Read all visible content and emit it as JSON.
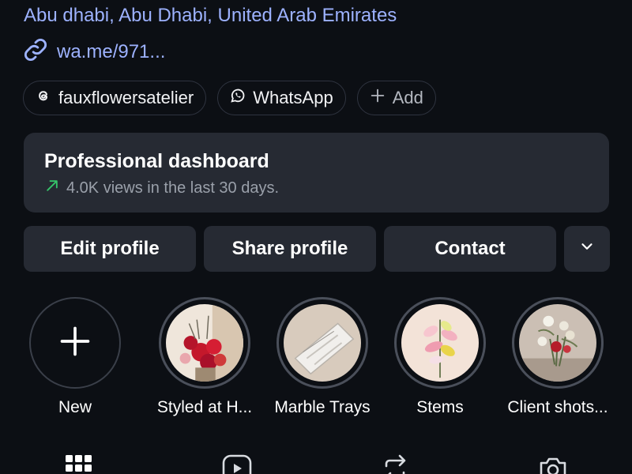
{
  "profile": {
    "location": "Abu dhabi, Abu Dhabi, United Arab Emirates",
    "link": "wa.me/971...",
    "link_icon": "link-icon"
  },
  "chips": [
    {
      "label": "fauxflowersatelier",
      "icon": "threads-icon"
    },
    {
      "label": "WhatsApp",
      "icon": "whatsapp-icon"
    },
    {
      "label": "Add",
      "icon": "plus-icon"
    }
  ],
  "dashboard": {
    "title": "Professional dashboard",
    "subtitle": "4.0K views in the last 30 days.",
    "trend_icon": "trend-up-icon",
    "trend_color": "#35c46a"
  },
  "actions": {
    "edit": "Edit profile",
    "share": "Share profile",
    "contact": "Contact",
    "more_icon": "chevron-down-icon"
  },
  "highlights": [
    {
      "label": "New"
    },
    {
      "label": "Styled at H..."
    },
    {
      "label": "Marble Trays"
    },
    {
      "label": "Stems"
    },
    {
      "label": "Client shots..."
    }
  ],
  "tabs": [
    {
      "icon": "grid-icon"
    },
    {
      "icon": "reels-icon"
    },
    {
      "icon": "repost-icon"
    },
    {
      "icon": "tagged-icon"
    }
  ],
  "colors": {
    "background": "#0c0f14",
    "card": "#262a33",
    "link": "#9db2ff"
  }
}
